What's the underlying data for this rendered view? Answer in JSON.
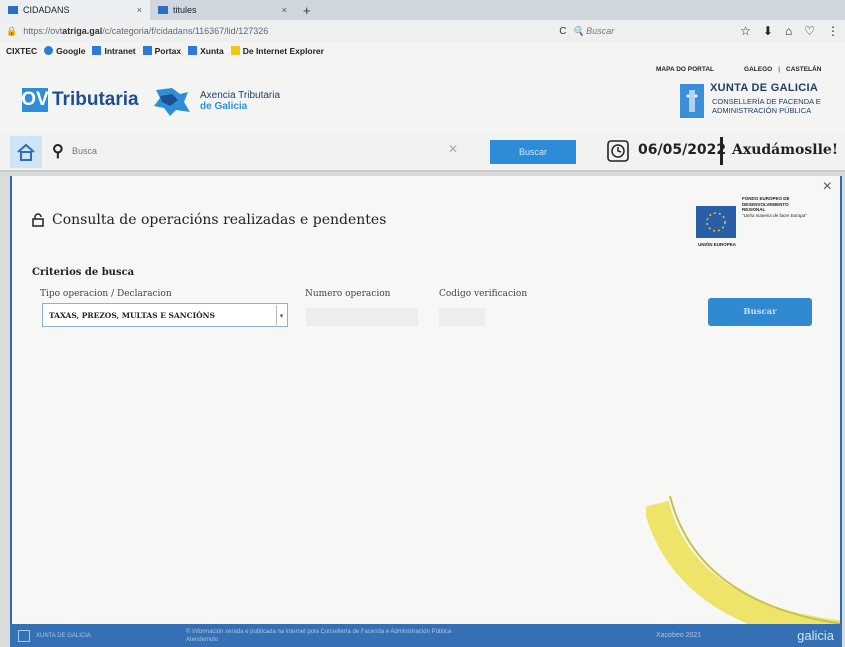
{
  "browser": {
    "tabs": [
      {
        "label": "CIDADANS",
        "close": "×"
      },
      {
        "label": "titules",
        "close": "×"
      }
    ],
    "new_tab": "+",
    "url_host": "atriga.gal",
    "url_rest": "/c/categoria/f/cidadans/116367/lid/127326",
    "url_prefix": "https://ovt",
    "search_placeholder": "Buscar",
    "reload": "C"
  },
  "bookmarks": [
    {
      "label": "CIXTEC",
      "color": ""
    },
    {
      "label": "Google",
      "color": "#2d7bd6"
    },
    {
      "label": "Intranet",
      "color": "#2d7bd6"
    },
    {
      "label": "Portax",
      "color": "#2d7bd6"
    },
    {
      "label": "Xunta",
      "color": "#2d7bd6"
    },
    {
      "label": "De Internet Explorer",
      "color": "#f0c419"
    }
  ],
  "header": {
    "ov": "OV",
    "tributaria": "Tributaria",
    "agency_line1": "Axencia Tributaria",
    "agency_line2": "de Galicia",
    "link_map": "MAPA DO PORTAL",
    "link_gal": "GALEGO",
    "link_sep": "|",
    "link_cas": "CASTELÁN",
    "xunta_title": "XUNTA DE GALICIA",
    "xunta_sub1": "CONSELLERÍA DE FACENDA E",
    "xunta_sub2": "ADMINISTRACIÓN PÚBLICA"
  },
  "search_row": {
    "placeholder": "Busca",
    "button": "Buscar",
    "date": "06/05/2022",
    "help": "Axudámoslle!"
  },
  "panel": {
    "close": "×",
    "title": "Consulta de operacións realizadas e pendentes",
    "eu_line1": "FONDO EUROPEO DE",
    "eu_line2": "DESENVOLVEMENTO",
    "eu_line3": "REXIONAL",
    "eu_motto": "\"Unha maneira de facer Europa\"",
    "eu_union": "UNIÓN EUROPEA",
    "criteria_title": "Criterios de busca",
    "label_type": "Tipo operacion / Declaracion",
    "label_number": "Numero operacion",
    "label_code": "Codigo verificacion",
    "type_value": "TAXAS, PREZOS, MULTAS E SANCIÓNS",
    "number_value": "",
    "code_value": "",
    "search_button": "Buscar"
  },
  "footer": {
    "xunta": "XUNTA DE GALICIA",
    "text": "© Información xerada e publicada na internet pola Consellería de Facenda e Administración Pública",
    "text2": "Atendemolo",
    "xacobeo": "Xacobeo 2021",
    "galicia": "galicia"
  }
}
